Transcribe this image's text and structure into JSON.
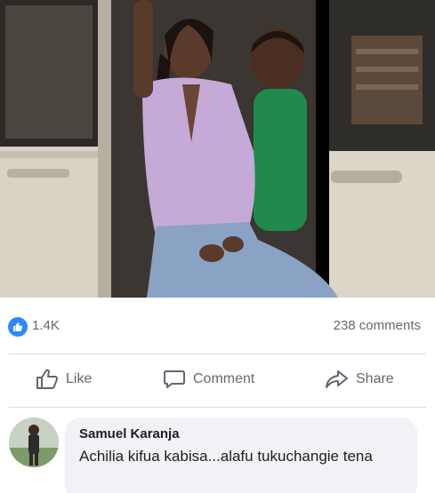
{
  "post": {
    "photo_icon": "photo-of-two-people-in-car-doorway",
    "reactions": {
      "icon": "thumbs-up-icon",
      "count": "1.4K"
    },
    "comments_count": "238 comments"
  },
  "actions": {
    "like_label": "Like",
    "comment_label": "Comment",
    "share_label": "Share"
  },
  "comment": {
    "author": "Samuel Karanja",
    "text": "Achilia kifua kabisa...alafu tukuchangie tena"
  },
  "colors": {
    "accent": "#2d88ff",
    "muted_text": "#65676b",
    "bubble": "#f0f2f5"
  }
}
